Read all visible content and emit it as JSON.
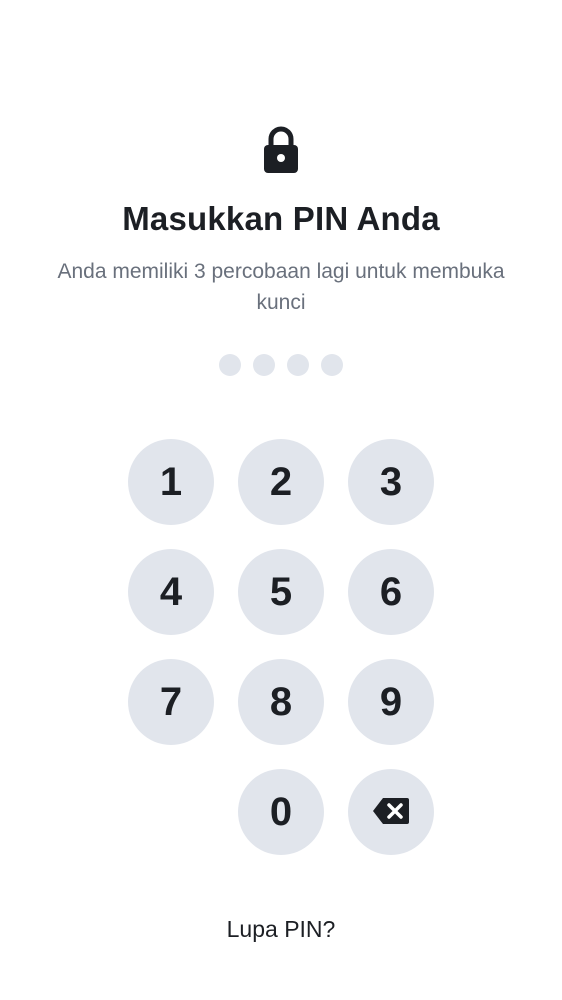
{
  "header": {
    "lock_icon": "lock-icon",
    "title": "Masukkan PIN Anda",
    "subtitle": "Anda memiliki 3 percobaan lagi untuk membuka kunci"
  },
  "pin": {
    "length": 4,
    "entered": 0
  },
  "keypad": {
    "keys": [
      "1",
      "2",
      "3",
      "4",
      "5",
      "6",
      "7",
      "8",
      "9",
      "0"
    ],
    "backspace_icon": "backspace-icon"
  },
  "footer": {
    "forgot_label": "Lupa PIN?"
  },
  "colors": {
    "key_background": "#e1e5ec",
    "text_primary": "#1c1f24",
    "text_secondary": "#69707c"
  }
}
